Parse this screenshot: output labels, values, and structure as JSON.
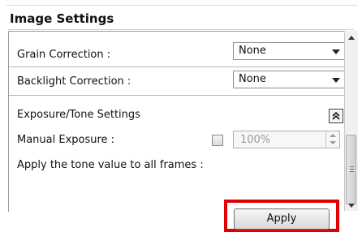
{
  "section": {
    "title": "Image Settings"
  },
  "grain_correction": {
    "label": "Grain Correction :",
    "value": "None"
  },
  "backlight_correction": {
    "label": "Backlight Correction :",
    "value": "None"
  },
  "exposure_tone": {
    "label": "Exposure/Tone Settings",
    "collapse_icon": "double-chevron-up-icon"
  },
  "manual_exposure": {
    "label": "Manual Exposure :",
    "checked": false,
    "value": "100%"
  },
  "apply_tone": {
    "label": "Apply the tone value to all frames :",
    "button_label": "Apply"
  },
  "highlight_color": "#e00000"
}
